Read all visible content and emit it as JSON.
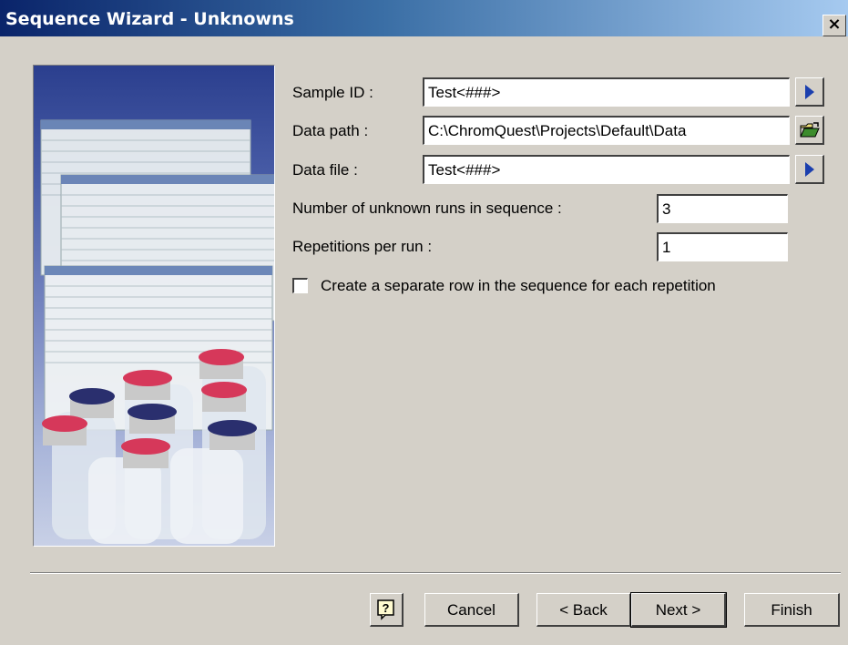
{
  "window": {
    "title": "Sequence Wizard - Unknowns",
    "close_glyph": "×"
  },
  "form": {
    "sample_id": {
      "label": "Sample ID :",
      "value": "Test<###>"
    },
    "data_path": {
      "label": "Data path :",
      "value": "C:\\ChromQuest\\Projects\\Default\\Data"
    },
    "data_file": {
      "label": "Data file :",
      "value": "Test<###>"
    },
    "num_runs": {
      "label": "Number of unknown runs in sequence :",
      "value": "3"
    },
    "repetitions": {
      "label": "Repetitions per run :",
      "value": "1"
    },
    "separate_row": {
      "label": "Create a separate row in the sequence for each repetition",
      "checked": false
    }
  },
  "buttons": {
    "help_glyph": "?",
    "cancel": "Cancel",
    "back": "< Back",
    "next": "Next >",
    "finish": "Finish"
  },
  "icons": {
    "sample_id_action": "right-arrow-icon",
    "data_path_action": "open-folder-icon",
    "data_file_action": "right-arrow-icon",
    "help": "help-icon"
  },
  "colors": {
    "title_gradient_start": "#0a246a",
    "title_gradient_end": "#a6caf0",
    "dialog_bg": "#d4d0c8",
    "arrow_blue": "#1b3fae",
    "folder_green": "#3c8c2c"
  }
}
